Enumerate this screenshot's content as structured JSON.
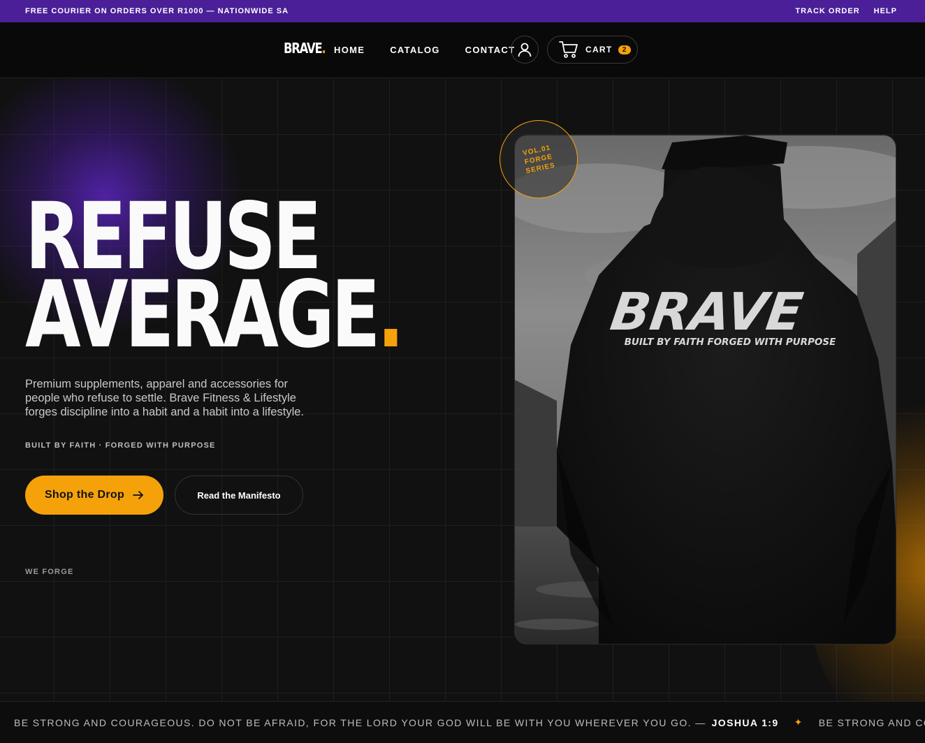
{
  "announcement": {
    "text": "FREE COURIER ON ORDERS OVER R1000 — NATIONWIDE SA",
    "links": [
      "TRACK ORDER",
      "HELP"
    ]
  },
  "header": {
    "logo": "BRAVE",
    "logo_dot": ".",
    "nav": [
      "HOME",
      "CATALOG",
      "CONTACT"
    ],
    "account_icon": "user-icon",
    "cart": {
      "label": "CART",
      "count": "2",
      "icon": "cart-icon"
    }
  },
  "hero": {
    "headline_line1": "REFUSE",
    "headline_line2": "AVERAGE",
    "headline_dot": ".",
    "lede": "Premium supplements, apparel and accessories for people who refuse to settle. Brave Fitness & Lifestyle forges discipline into a habit and a habit into a lifestyle.",
    "tagline": "BUILT BY FAITH · FORGED WITH PURPOSE",
    "primary_cta": "Shop the Drop",
    "secondary_cta": "Read the Manifesto",
    "footnote": "WE FORGE",
    "stamp": [
      "VOL.01",
      "FORGE",
      "SERIES"
    ],
    "hoodie_print": {
      "brand": "BRAVE",
      "slogan": "BUILT BY FAITH FORGED WITH PURPOSE"
    }
  },
  "marquee": {
    "verse": "BE STRONG AND COURAGEOUS. DO NOT BE AFRAID, FOR THE LORD YOUR GOD WILL BE WITH YOU WHEREVER YOU GO. —",
    "reference": "JOSHUA 1:9",
    "repeat": "BE STRONG AND COURAGEOUS."
  },
  "colors": {
    "accent": "#f5a20a",
    "brand_purple": "#4a1f98",
    "background": "#111111"
  }
}
